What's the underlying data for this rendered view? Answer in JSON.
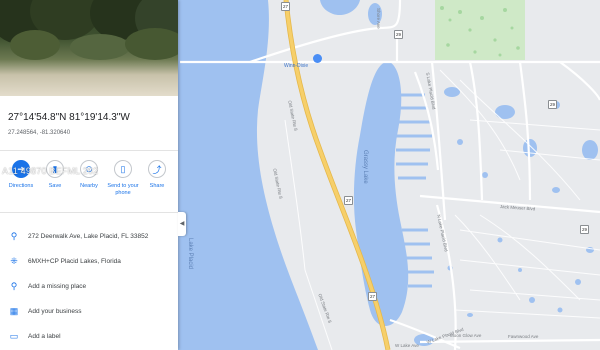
{
  "place": {
    "coordinates": "27°14'54.8\"N 81°19'14.3\"W",
    "decimal": "27.248564, -81.320640"
  },
  "actions": [
    {
      "label": "Directions",
      "icon": "directions-icon"
    },
    {
      "label": "Save",
      "icon": "bookmark-icon"
    },
    {
      "label": "Nearby",
      "icon": "nearby-icon"
    },
    {
      "label": "Send to your phone",
      "label_l1": "Send to your",
      "label_l2": "phone",
      "icon": "phone-icon"
    },
    {
      "label": "Share",
      "icon": "share-icon"
    }
  ],
  "details": [
    {
      "text": "272 Deerwalk Ave, Lake Placid, FL 33852",
      "icon": "location-pin-icon"
    },
    {
      "text": "6MXH+CP Placid Lakes, Florida",
      "icon": "plus-code-icon"
    },
    {
      "text": "Add a missing place",
      "icon": "add-place-icon"
    },
    {
      "text": "Add your business",
      "icon": "business-icon"
    },
    {
      "text": "Add a label",
      "icon": "label-icon"
    }
  ],
  "watermark": "A11 49870 BEFML 202",
  "map": {
    "poi": "Winn-Dixie",
    "water_labels": [
      "Grassy Lake",
      "Lake Placid"
    ],
    "road_labels": [
      "Old State Rte 8",
      "Old State Rte 8",
      "Old State Rte 8",
      "Jack Meuser Blvd",
      "S Lake Placid Blvd",
      "N Lake Placid Blvd",
      "W Lake Placid Blvd",
      "Moon Glow Ave",
      "Fawnwood Ave",
      "Shore Ave",
      "W Lake Ave"
    ],
    "shields": [
      "27",
      "27",
      "27",
      "29",
      "29",
      "29"
    ],
    "colors": {
      "land": "#e8eaed",
      "water": "#9fc1f0",
      "highway": "#f6cf6a",
      "road": "#ffffff",
      "pin": "#ea4335"
    }
  }
}
